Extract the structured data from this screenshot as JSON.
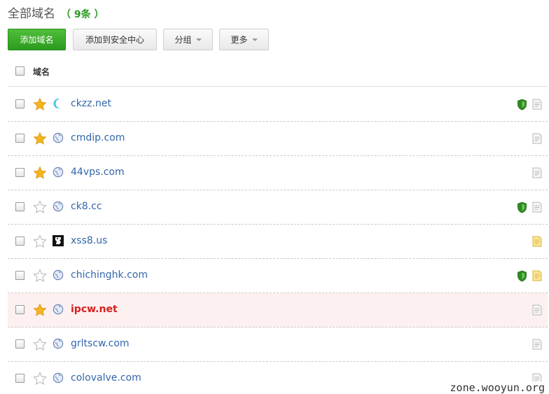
{
  "page": {
    "title": "全部域名",
    "count": "（ 9条 ）"
  },
  "toolbar": {
    "add_domain": "添加域名",
    "add_security": "添加到安全中心",
    "group": "分组",
    "more": "更多"
  },
  "table": {
    "header_label": "域名"
  },
  "colors": {
    "primary_green": "#2b9a1e",
    "link_blue": "#3366aa",
    "highlight_red": "#d81e1e",
    "highlight_row_bg": "#fdf0f0",
    "star_gold": "#f5b51c",
    "shield_green": "#2e8b1f"
  },
  "domains": [
    {
      "name": "ckzz.net",
      "starred": true,
      "icon": "moon-favicon-icon",
      "shield": true,
      "note_active": false,
      "highlight": false
    },
    {
      "name": "cmdip.com",
      "starred": true,
      "icon": "globe-icon",
      "shield": false,
      "note_active": false,
      "highlight": false
    },
    {
      "name": "44vps.com",
      "starred": true,
      "icon": "globe-icon",
      "shield": false,
      "note_active": false,
      "highlight": false
    },
    {
      "name": "ck8.cc",
      "starred": false,
      "icon": "globe-icon",
      "shield": true,
      "note_active": false,
      "highlight": false
    },
    {
      "name": "xss8.us",
      "starred": false,
      "icon": "ghost-favicon-icon",
      "shield": false,
      "note_active": true,
      "highlight": false
    },
    {
      "name": "chichinghk.com",
      "starred": false,
      "icon": "globe-icon",
      "shield": true,
      "note_active": true,
      "highlight": false
    },
    {
      "name": "ipcw.net",
      "starred": true,
      "icon": "globe-icon",
      "shield": false,
      "note_active": false,
      "highlight": true
    },
    {
      "name": "grltscw.com",
      "starred": false,
      "icon": "globe-icon",
      "shield": false,
      "note_active": false,
      "highlight": false
    },
    {
      "name": "colovalve.com",
      "starred": false,
      "icon": "globe-icon",
      "shield": false,
      "note_active": false,
      "highlight": false
    }
  ],
  "watermark": "zone.wooyun.org"
}
